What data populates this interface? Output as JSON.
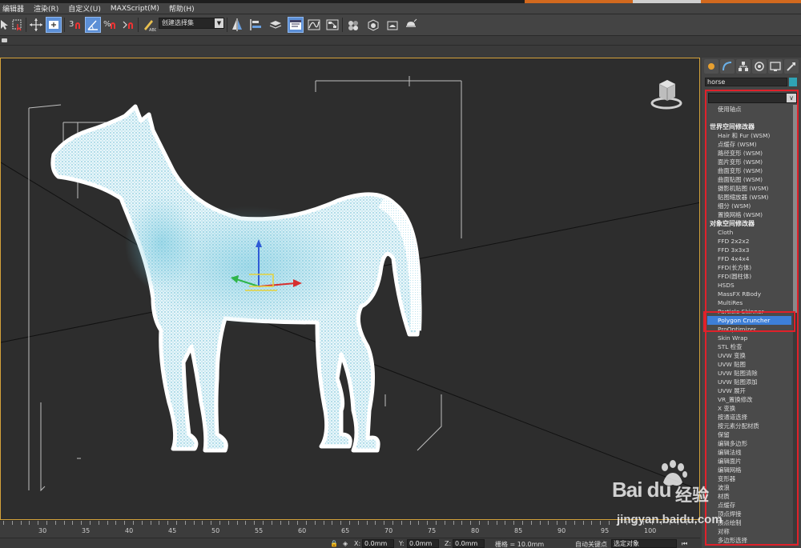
{
  "menu": [
    "编辑器",
    "渲染(R)",
    "自定义(U)",
    "MAXScript(M)",
    "帮助(H)"
  ],
  "toolbar": {
    "selection_set": "创建选择集"
  },
  "command_panel": {
    "object_name": "horse",
    "object_color": "#2fa3b5",
    "modifier_list": {
      "items": [
        {
          "kind": "item",
          "label": "使用轴点"
        },
        {
          "kind": "gap",
          "label": ""
        },
        {
          "kind": "head",
          "label": "世界空间修改器"
        },
        {
          "kind": "item",
          "label": "Hair 和 Fur (WSM)"
        },
        {
          "kind": "item",
          "label": "点缓存 (WSM)"
        },
        {
          "kind": "item",
          "label": "路径变形 (WSM)"
        },
        {
          "kind": "item",
          "label": "面片变形 (WSM)"
        },
        {
          "kind": "item",
          "label": "曲面变形 (WSM)"
        },
        {
          "kind": "item",
          "label": "曲面贴图 (WSM)"
        },
        {
          "kind": "item",
          "label": "摄影机贴图 (WSM)"
        },
        {
          "kind": "item",
          "label": "贴图缩放器 (WSM)"
        },
        {
          "kind": "item",
          "label": "细分 (WSM)"
        },
        {
          "kind": "item",
          "label": "置换网格 (WSM)"
        },
        {
          "kind": "head",
          "label": "对象空间修改器"
        },
        {
          "kind": "item",
          "label": "Cloth"
        },
        {
          "kind": "item",
          "label": "FFD 2x2x2"
        },
        {
          "kind": "item",
          "label": "FFD 3x3x3"
        },
        {
          "kind": "item",
          "label": "FFD 4x4x4"
        },
        {
          "kind": "item",
          "label": "FFD(长方体)"
        },
        {
          "kind": "item",
          "label": "FFD(圆柱体)"
        },
        {
          "kind": "item",
          "label": "HSDS"
        },
        {
          "kind": "item",
          "label": "MassFX RBody"
        },
        {
          "kind": "item",
          "label": "MultiRes"
        },
        {
          "kind": "item",
          "label": "Particle Skinner"
        },
        {
          "kind": "selected",
          "label": "Polygon Cruncher"
        },
        {
          "kind": "item",
          "label": "ProOptimizer"
        },
        {
          "kind": "item",
          "label": "Skin Wrap"
        },
        {
          "kind": "item",
          "label": "STL 检查"
        },
        {
          "kind": "item",
          "label": "UVW 变换"
        },
        {
          "kind": "item",
          "label": "UVW 贴图"
        },
        {
          "kind": "item",
          "label": "UVW 贴图清除"
        },
        {
          "kind": "item",
          "label": "UVW 贴图添加"
        },
        {
          "kind": "item",
          "label": "UVW 展开"
        },
        {
          "kind": "item",
          "label": "VR_置换修改"
        },
        {
          "kind": "item",
          "label": "X 变换"
        },
        {
          "kind": "item",
          "label": "按通道选择"
        },
        {
          "kind": "item",
          "label": "按元素分配材质"
        },
        {
          "kind": "item",
          "label": "保留"
        },
        {
          "kind": "item",
          "label": "编辑多边形"
        },
        {
          "kind": "item",
          "label": "编辑法线"
        },
        {
          "kind": "item",
          "label": "编辑面片"
        },
        {
          "kind": "item",
          "label": "编辑网格"
        },
        {
          "kind": "item",
          "label": "变形器"
        },
        {
          "kind": "item",
          "label": "波浪"
        },
        {
          "kind": "item",
          "label": "材质"
        },
        {
          "kind": "item",
          "label": "点缓存"
        },
        {
          "kind": "item",
          "label": "顶点焊接"
        },
        {
          "kind": "item",
          "label": "顶点绘制"
        },
        {
          "kind": "item",
          "label": "对称"
        },
        {
          "kind": "item",
          "label": "多边形选择"
        }
      ]
    }
  },
  "timeline": {
    "ticks": [
      "30",
      "35",
      "40",
      "45",
      "50",
      "55",
      "60",
      "65",
      "70",
      "75",
      "80",
      "85",
      "90",
      "95",
      "100"
    ]
  },
  "status": {
    "x_label": "X:",
    "x_value": "0.0mm",
    "y_label": "Y:",
    "y_value": "0.0mm",
    "z_label": "Z:",
    "z_value": "0.0mm",
    "grid": "栅格 = 10.0mm",
    "autokey": "自动关键点",
    "selected": "选定对象"
  },
  "watermark": {
    "brand": "Bai du",
    "cn": "经验",
    "url": "jingyan.baidu.com"
  }
}
